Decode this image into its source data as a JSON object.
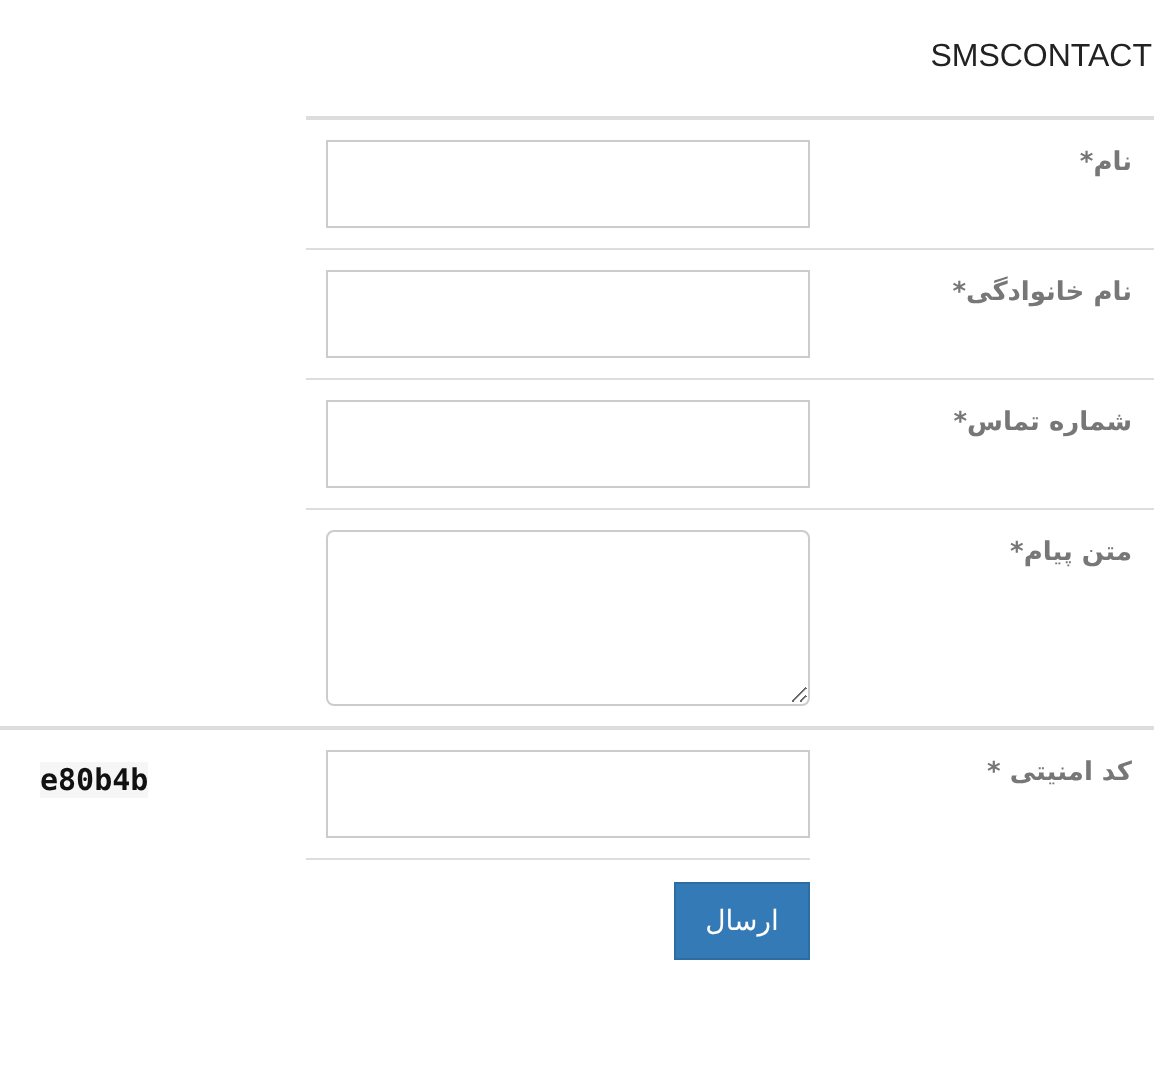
{
  "title": "SMSCONTACT",
  "fields": [
    {
      "label": "نام*",
      "kind": "input"
    },
    {
      "label": "نام خانوادگی*",
      "kind": "input"
    },
    {
      "label": "شماره تماس*",
      "kind": "input"
    },
    {
      "label": "متن پیام*",
      "kind": "textarea"
    }
  ],
  "captcha": {
    "label": "کد امنیتی *",
    "code": "e80b4b"
  },
  "submit": "ارسال"
}
